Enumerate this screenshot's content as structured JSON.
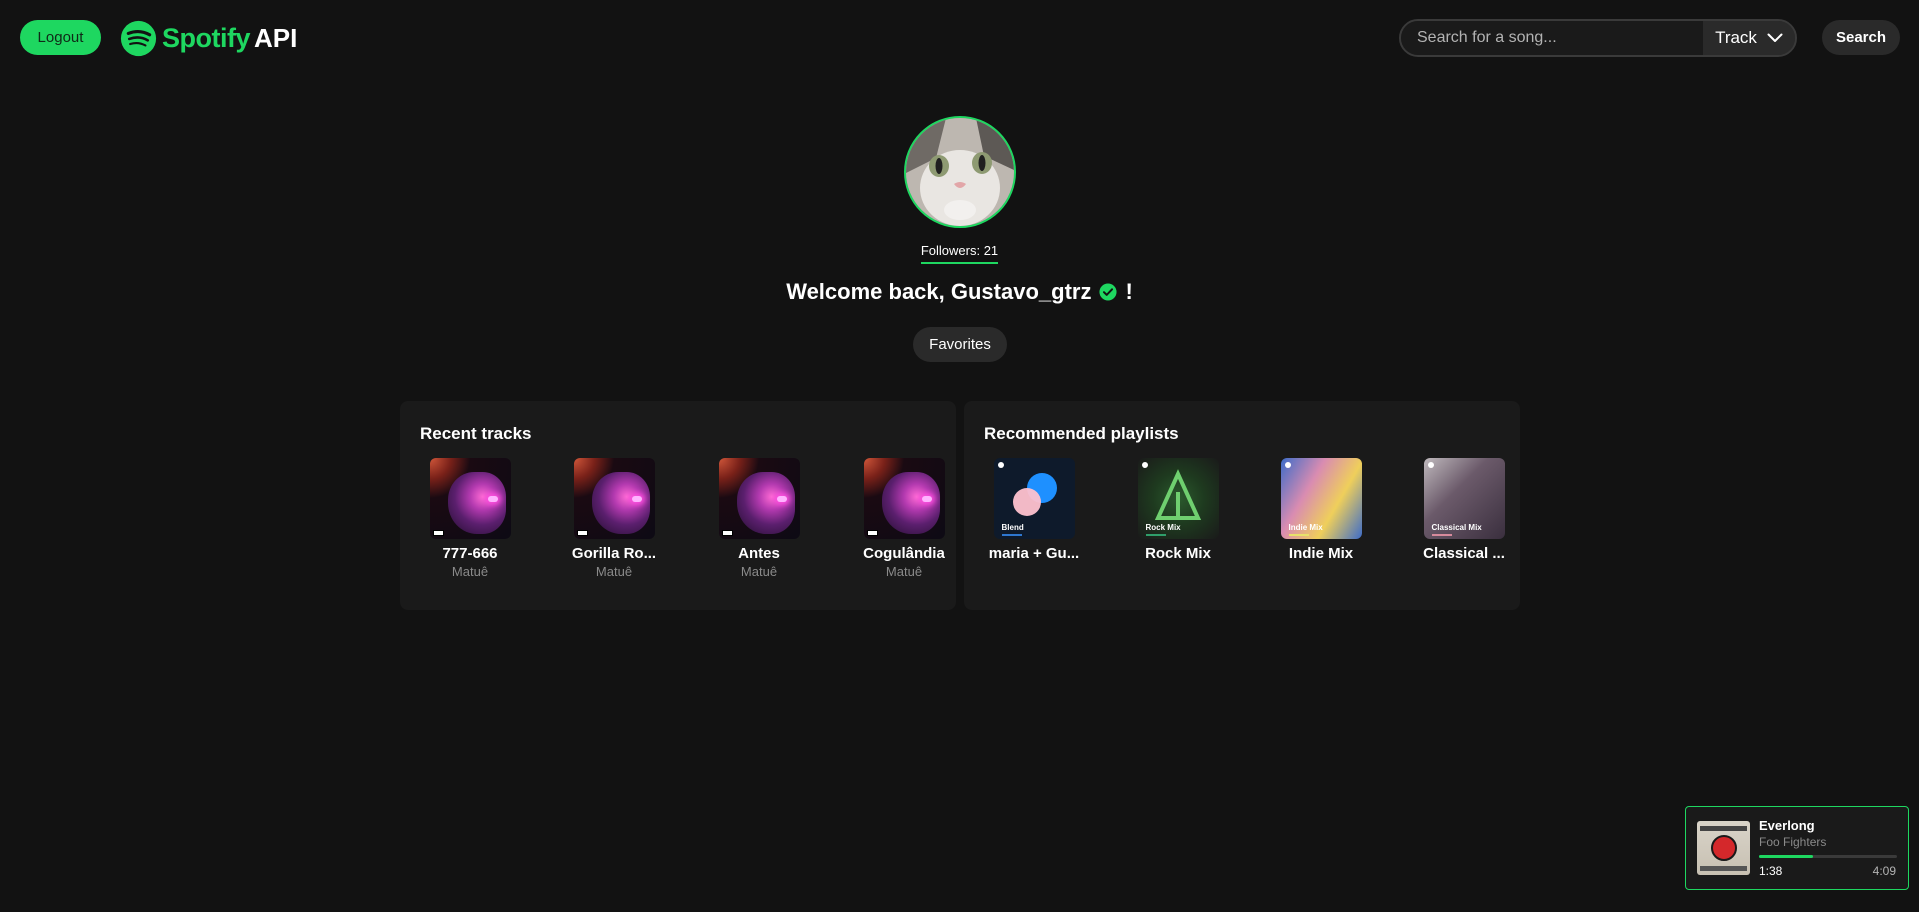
{
  "header": {
    "logout_label": "Logout",
    "logo_word": "Spotify",
    "logo_suffix": "API",
    "search_placeholder": "Search for a song...",
    "search_type": "Track",
    "search_button_label": "Search"
  },
  "profile": {
    "followers": "Followers: 21",
    "welcome": "Welcome back, Gustavo_gtrz",
    "welcome_suffix": "!",
    "favorites_label": "Favorites"
  },
  "recent_tracks": {
    "title": "Recent tracks",
    "items": [
      {
        "title": "777-666",
        "artist": "Matuê"
      },
      {
        "title": "Gorilla Ro...",
        "artist": "Matuê"
      },
      {
        "title": "Antes",
        "artist": "Matuê"
      },
      {
        "title": "Cogulândia",
        "artist": "Matuê"
      }
    ]
  },
  "recommended_playlists": {
    "title": "Recommended playlists",
    "items": [
      {
        "title": "maria + Gu...",
        "cover_label": "Blend",
        "accent": "#2e77d0"
      },
      {
        "title": "Rock Mix",
        "cover_label": "Rock Mix",
        "accent": "#2f9e6a"
      },
      {
        "title": "Indie Mix",
        "cover_label": "Indie Mix",
        "accent": "#e8e26a"
      },
      {
        "title": "Classical ...",
        "cover_label": "Classical Mix",
        "accent": "#d78a9c"
      }
    ]
  },
  "now_playing": {
    "title": "Everlong",
    "artist": "Foo Fighters",
    "current_time": "1:38",
    "total_time": "4:09",
    "progress": 0.39
  },
  "colors": {
    "accent": "#1ed760",
    "background": "#121212",
    "panel": "#1a1a1a"
  }
}
